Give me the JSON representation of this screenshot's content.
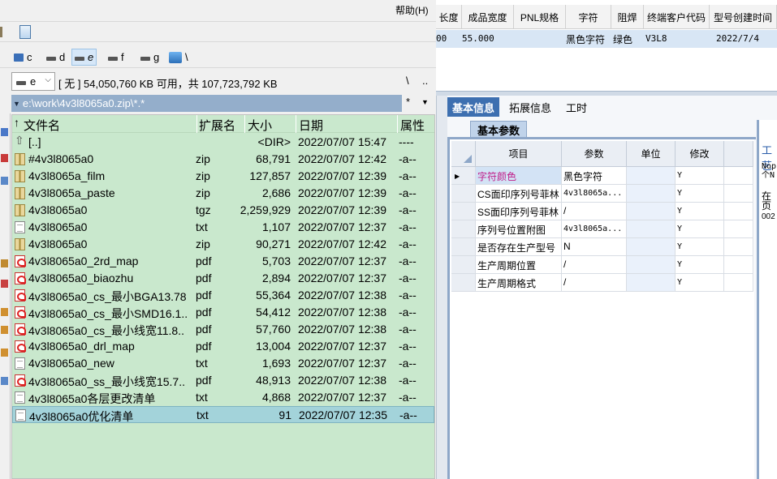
{
  "file_manager": {
    "menu_help": "帮助(H)",
    "drives": [
      {
        "letter": "c",
        "icon": "network-drive-icon"
      },
      {
        "letter": "d",
        "icon": "hard-drive-icon"
      },
      {
        "letter": "e",
        "icon": "hard-drive-icon",
        "active": true
      },
      {
        "letter": "f",
        "icon": "hard-drive-icon"
      },
      {
        "letter": "g",
        "icon": "hard-drive-icon"
      },
      {
        "letter": "\\",
        "icon": "network-share-icon"
      }
    ],
    "current_drive": "e",
    "free_space": "[ 无 ]  54,050,760 KB 可用，共 107,723,792 KB",
    "root_button": "\\",
    "up_button": "..",
    "path": "e:\\work\\4v3l8065a0.zip\\*.*",
    "filter_button": "*",
    "columns": {
      "name": "文件名",
      "ext": "扩展名",
      "size": "大小",
      "date": "日期",
      "attr": "属性"
    },
    "files": [
      {
        "name": "[..]",
        "ext": "",
        "size": "<DIR>",
        "date": "2022/07/07 15:47",
        "attr": "----",
        "icon": "up"
      },
      {
        "name": "#4v3l8065a0",
        "ext": "zip",
        "size": "68,791",
        "date": "2022/07/07 12:42",
        "attr": "-a--",
        "icon": "zip"
      },
      {
        "name": "4v3l8065a_film",
        "ext": "zip",
        "size": "127,857",
        "date": "2022/07/07 12:39",
        "attr": "-a--",
        "icon": "zip"
      },
      {
        "name": "4v3l8065a_paste",
        "ext": "zip",
        "size": "2,686",
        "date": "2022/07/07 12:39",
        "attr": "-a--",
        "icon": "zip"
      },
      {
        "name": "4v3l8065a0",
        "ext": "tgz",
        "size": "2,259,929",
        "date": "2022/07/07 12:39",
        "attr": "-a--",
        "icon": "zip"
      },
      {
        "name": "4v3l8065a0",
        "ext": "txt",
        "size": "1,107",
        "date": "2022/07/07 12:37",
        "attr": "-a--",
        "icon": "txt"
      },
      {
        "name": "4v3l8065a0",
        "ext": "zip",
        "size": "90,271",
        "date": "2022/07/07 12:42",
        "attr": "-a--",
        "icon": "zip"
      },
      {
        "name": "4v3l8065a0_2rd_map",
        "ext": "pdf",
        "size": "5,703",
        "date": "2022/07/07 12:37",
        "attr": "-a--",
        "icon": "pdf"
      },
      {
        "name": "4v3l8065a0_biaozhu",
        "ext": "pdf",
        "size": "2,894",
        "date": "2022/07/07 12:37",
        "attr": "-a--",
        "icon": "pdf"
      },
      {
        "name": "4v3l8065a0_cs_最小BGA13.78",
        "ext": "pdf",
        "size": "55,364",
        "date": "2022/07/07 12:38",
        "attr": "-a--",
        "icon": "pdf"
      },
      {
        "name": "4v3l8065a0_cs_最小SMD16.1..",
        "ext": "pdf",
        "size": "54,412",
        "date": "2022/07/07 12:38",
        "attr": "-a--",
        "icon": "pdf"
      },
      {
        "name": "4v3l8065a0_cs_最小线宽11.8..",
        "ext": "pdf",
        "size": "57,760",
        "date": "2022/07/07 12:38",
        "attr": "-a--",
        "icon": "pdf"
      },
      {
        "name": "4v3l8065a0_drl_map",
        "ext": "pdf",
        "size": "13,004",
        "date": "2022/07/07 12:37",
        "attr": "-a--",
        "icon": "pdf"
      },
      {
        "name": "4v3l8065a0_new",
        "ext": "txt",
        "size": "1,693",
        "date": "2022/07/07 12:37",
        "attr": "-a--",
        "icon": "txt"
      },
      {
        "name": "4v3l8065a0_ss_最小线宽15.7..",
        "ext": "pdf",
        "size": "48,913",
        "date": "2022/07/07 12:38",
        "attr": "-a--",
        "icon": "pdf"
      },
      {
        "name": "4v3l8065a0各层更改清单",
        "ext": "txt",
        "size": "4,868",
        "date": "2022/07/07 12:37",
        "attr": "-a--",
        "icon": "txt"
      },
      {
        "name": "4v3l8065a0优化清单",
        "ext": "txt",
        "size": "91",
        "date": "2022/07/07 12:35",
        "attr": "-a--",
        "icon": "txt",
        "selected": true
      }
    ]
  },
  "erp": {
    "headers": [
      "长度",
      "成品宽度",
      "PNL规格",
      "字符",
      "阻焊",
      "终端客户代码",
      "型号创建时间"
    ],
    "row": [
      "00",
      "55.000",
      "",
      "黑色字符",
      "绿色",
      "V3L8",
      "2022/7/4"
    ],
    "tabs": [
      "基本信息",
      "拓展信息",
      "工时"
    ],
    "subtab": "基本参数",
    "grid_headers": [
      "项目",
      "参数",
      "单位",
      "修改"
    ],
    "grid_rows": [
      {
        "item": "字符颜色",
        "param": "黑色字符",
        "unit": "",
        "edit": "Y",
        "current": true
      },
      {
        "item": "CS面印序列号菲林",
        "param": "4v3l8065a...",
        "unit": "",
        "edit": "Y"
      },
      {
        "item": "SS面印序列号菲林",
        "param": "/",
        "unit": "",
        "edit": "Y"
      },
      {
        "item": "序列号位置附图",
        "param": "4v3l8065a...",
        "unit": "",
        "edit": "Y"
      },
      {
        "item": "是否存在生产型号",
        "param": "N",
        "unit": "",
        "edit": "Y"
      },
      {
        "item": "生产周期位置",
        "param": "/",
        "unit": "",
        "edit": "Y"
      },
      {
        "item": "生产周期格式",
        "param": "/",
        "unit": "",
        "edit": "Y"
      }
    ],
    "side_panel": {
      "title": "工艺",
      "line1": "Nop",
      "line2": "个N",
      "line3": "在页",
      "line4": "002"
    }
  }
}
